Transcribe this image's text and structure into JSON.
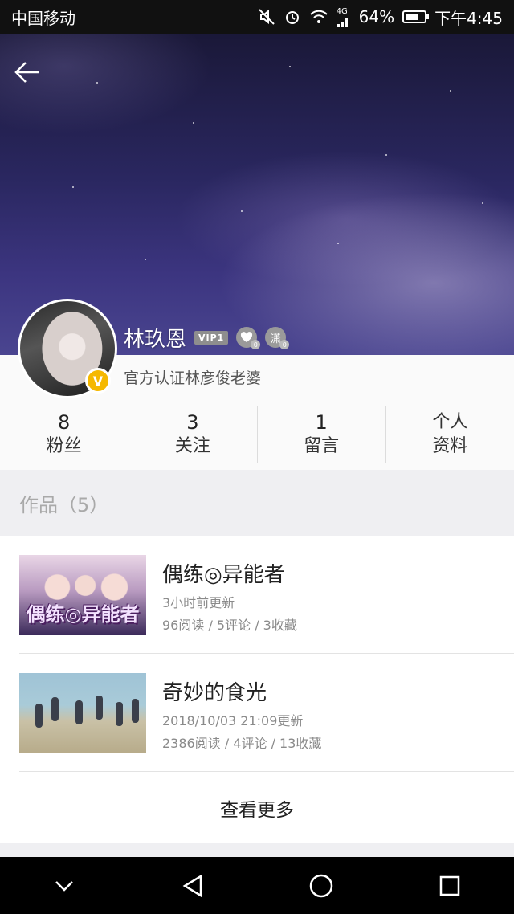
{
  "status_bar": {
    "carrier": "中国移动",
    "network": "4G",
    "battery": "64%",
    "time": "下午4:45",
    "icons": [
      "mute-icon",
      "alarm-icon",
      "wifi-icon",
      "signal-icon",
      "battery-icon"
    ]
  },
  "banner": {
    "back_icon": "arrow-left-icon"
  },
  "profile": {
    "name": "林玖恩",
    "vip_label": "VIP1",
    "badge_heart_count": "0",
    "badge_water_label": "潇",
    "badge_water_count": "0",
    "verified_label": "V",
    "signature": "官方认证林彦俊老婆",
    "stats": [
      {
        "num": "8",
        "label": "粉丝"
      },
      {
        "num": "3",
        "label": "关注"
      },
      {
        "num": "1",
        "label": "留言"
      },
      {
        "num": "个人",
        "label": "资料"
      }
    ]
  },
  "works": {
    "header": "作品（5）",
    "items": [
      {
        "title": "偶练◎异能者",
        "thumb_caption": "偶练◎异能者",
        "updated": "3小时前更新",
        "stats": "96阅读 / 5评论 / 3收藏"
      },
      {
        "title": "奇妙的食光",
        "updated": "2018/10/03 21:09更新",
        "stats": "2386阅读 / 4评论 / 13收藏"
      }
    ],
    "more_label": "查看更多"
  },
  "nav_bar": {
    "icons": [
      "chevron-down-icon",
      "back-triangle-icon",
      "home-circle-icon",
      "recents-square-icon"
    ]
  }
}
